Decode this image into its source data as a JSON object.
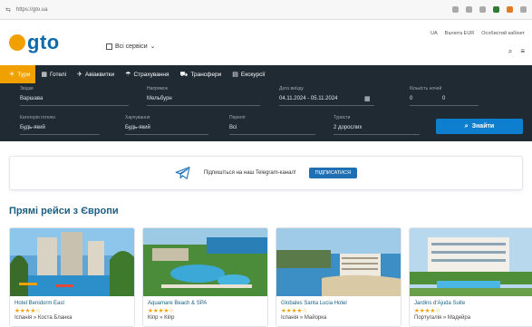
{
  "browser": {
    "url": "https://gto.ua"
  },
  "header": {
    "logo_text": "gto",
    "all_services": "Всі сервіси",
    "links": [
      "UA",
      "Валюта EUR",
      "Особистий кабінет"
    ]
  },
  "nav": {
    "tabs": [
      {
        "label": "Тури",
        "icon": "sun-icon",
        "active": true
      },
      {
        "label": "Готелі",
        "icon": "hotel-icon",
        "active": false
      },
      {
        "label": "Авіаквитки",
        "icon": "plane-icon",
        "active": false
      },
      {
        "label": "Страхування",
        "icon": "umbrella-icon",
        "active": false
      },
      {
        "label": "Трансфери",
        "icon": "car-icon",
        "active": false
      },
      {
        "label": "Екскурсії",
        "icon": "ticket-icon",
        "active": false
      }
    ]
  },
  "search": {
    "from_label": "Звідки",
    "from_value": "Варшава",
    "to_label": "Напрямок",
    "to_value": "Мельбурн",
    "dates_label": "Дата виїзду",
    "dates_value": "04.11.2024 - 05.11.2024",
    "nights_label": "Кількість ночей",
    "nights_from": "0",
    "nights_to": "0",
    "rooms_label": "Категорія готелю",
    "rooms_value": "Будь-який",
    "meal_label": "Харчування",
    "meal_value": "Будь-який",
    "stars_label": "Переліт",
    "stars_value": "Всі",
    "tourists_label": "Туристи",
    "tourists_value": "2 дорослих",
    "submit": "Знайти"
  },
  "telegram": {
    "text": "Підпишіться на наш Telegram-канал!",
    "button": "ПІДПИСАТИСЯ"
  },
  "section": {
    "title": "Прямі рейси з Європи"
  },
  "cards": [
    {
      "name": "Hotel Benidorm East",
      "stars": "★★★★☆",
      "location": "Іспанія » Коста Бланка"
    },
    {
      "name": "Aquamare Beach & SPA",
      "stars": "★★★★☆",
      "location": "Кіпр » Кіпр"
    },
    {
      "name": "Globales Santa Lucia Hotel",
      "stars": "★★★★☆",
      "location": "Іспанія » Майорка"
    },
    {
      "name": "Jardins d'Ajuda Suite",
      "stars": "★★★★☆",
      "location": "Португалія » Мадейра"
    }
  ]
}
